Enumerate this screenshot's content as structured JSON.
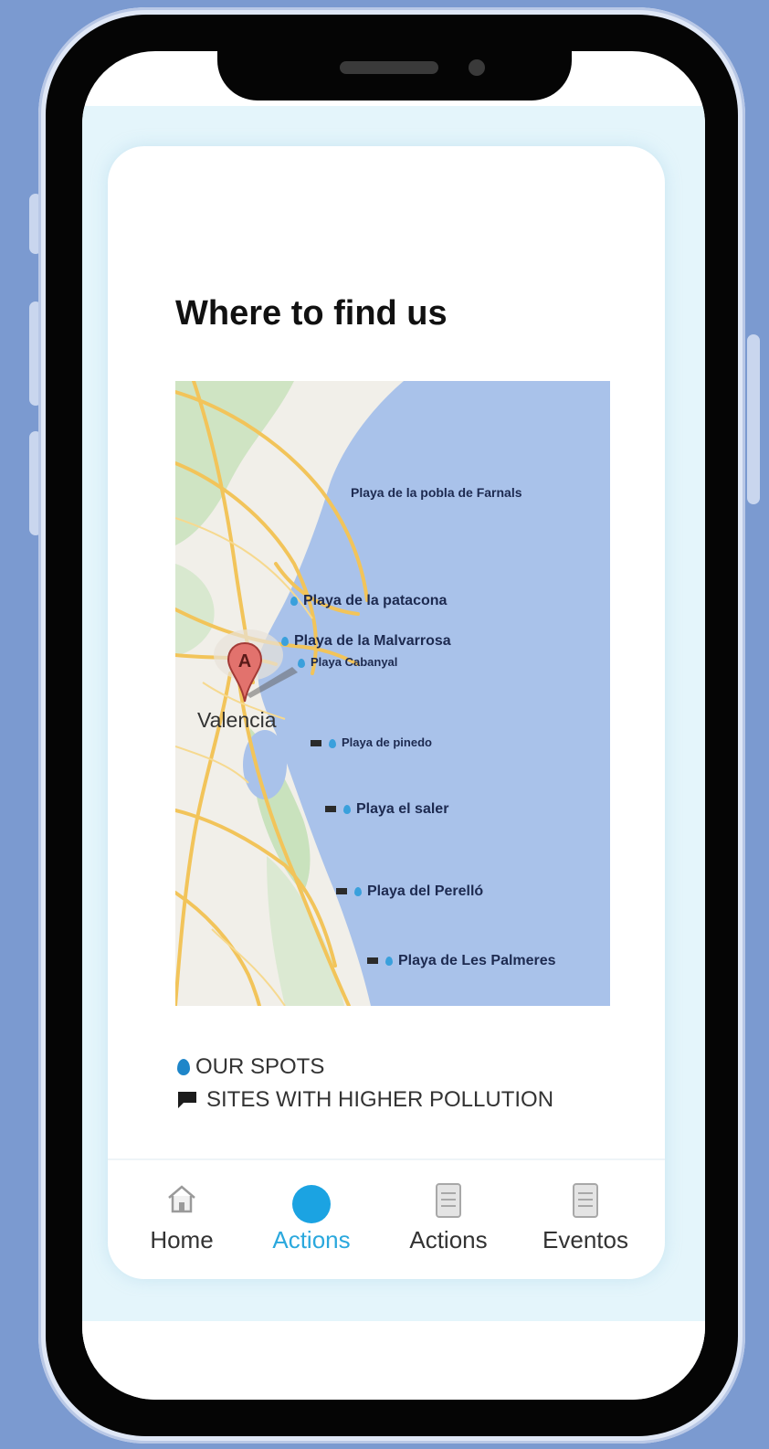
{
  "page": {
    "title": "Where to find us"
  },
  "map": {
    "city": "Valencia",
    "pin_label": "A",
    "beaches": [
      {
        "name": "Playa de la pobla de Farnals",
        "marker": "none"
      },
      {
        "name": "Playa de la patacona",
        "marker": "drop"
      },
      {
        "name": "Playa de la Malvarrosa",
        "marker": "drop"
      },
      {
        "name": "Playa Cabanyal",
        "marker": "drop"
      },
      {
        "name": "Playa de pinedo",
        "marker": "flag+drop"
      },
      {
        "name": "Playa el saler",
        "marker": "flag+drop"
      },
      {
        "name": "Playa del Perelló",
        "marker": "flag+drop"
      },
      {
        "name": "Playa de Les Palmeres",
        "marker": "flag+drop"
      }
    ]
  },
  "legend": {
    "spots": "OUR SPOTS",
    "pollution": "SITES WITH HIGHER POLLUTION"
  },
  "nav": {
    "items": [
      {
        "label": "Home",
        "icon": "home-icon",
        "active": false
      },
      {
        "label": "Actions",
        "icon": "circle-icon",
        "active": true
      },
      {
        "label": "Actions",
        "icon": "document-icon",
        "active": false
      },
      {
        "label": "Eventos",
        "icon": "document-icon",
        "active": false
      }
    ]
  },
  "colors": {
    "background": "#7b9ad0",
    "accent": "#2aa8dd",
    "sea": "#a9c2ea",
    "drop": "#1f86c9"
  }
}
